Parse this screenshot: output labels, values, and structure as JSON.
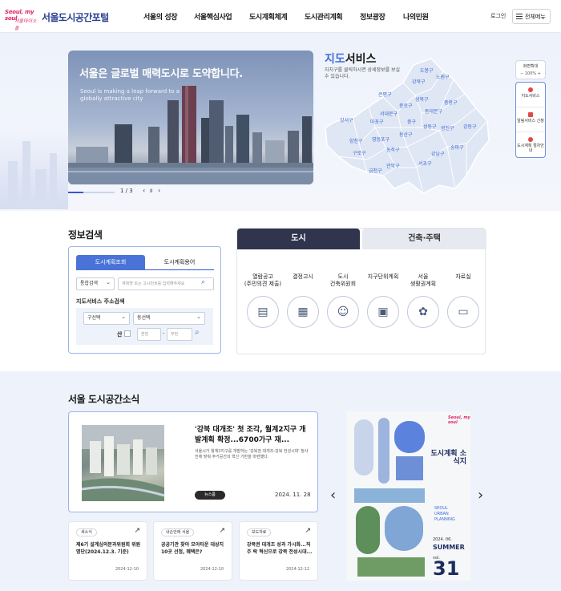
{
  "header": {
    "logo_small1": "Seoul, my soul",
    "logo_small2": "서울마이소울",
    "logo_text": "서울도시공간포털",
    "nav": [
      "서울의 성장",
      "서울핵심사업",
      "도시계획체계",
      "도시관리계획",
      "정보광장",
      "나의민원"
    ],
    "login": "로그인",
    "all_menu": "전체메뉴"
  },
  "hero": {
    "title": "서울은 글로벌 매력도시로 도약합니다.",
    "subtitle": "Seoul is making a leap forward to a globally attractive city",
    "page": "1 / 3",
    "progress": 0.33,
    "prev": "‹",
    "pause": "II",
    "next": "›"
  },
  "map": {
    "title_accent": "지도",
    "title_rest": "서비스",
    "desc": "자치구를 클릭하시면 상세정보를 보실 수 있습니다.",
    "districts": [
      "도봉구",
      "강북구",
      "노원구",
      "은평구",
      "성북구",
      "중랑구",
      "종로구",
      "동대문구",
      "서대문구",
      "강서구",
      "마포구",
      "중구",
      "성동구",
      "광진구",
      "강동구",
      "양천구",
      "용산구",
      "영등포구",
      "동작구",
      "구로구",
      "강남구",
      "송파구",
      "금천구",
      "관악구",
      "서초구"
    ]
  },
  "quick": {
    "zoom_label": "화면확대",
    "zoom_value": "100%",
    "zoom_minus": "−",
    "zoom_plus": "+",
    "items": [
      "지도서비스",
      "알림서비스 신청",
      "도시계획 절차안내"
    ]
  },
  "info_search": {
    "title": "정보검색",
    "tabs": [
      "도시계획조회",
      "도시계획용어"
    ],
    "select_type": "통합검색",
    "search_placeholder": "계획명 또는 고시번호를 입력해주세요",
    "address_label": "지도서비스 주소검색",
    "gu_select": "구선택",
    "dong_select": "동선택",
    "mountain": "산",
    "main_num": "본번",
    "sub_num": "부번",
    "dash": "-"
  },
  "category": {
    "tabs": [
      "도시",
      "건축·주택"
    ],
    "items": [
      {
        "label": "열람공고\n(주민의견 제출)",
        "icon": "chat-icon",
        "glyph": "▤"
      },
      {
        "label": "결정고시",
        "icon": "document-icon",
        "glyph": "▦"
      },
      {
        "label": "도시\n건축위원회",
        "icon": "committee-icon",
        "glyph": "☺"
      },
      {
        "label": "지구단위계획",
        "icon": "plan-icon",
        "glyph": "▣"
      },
      {
        "label": "서울\n생활권계획",
        "icon": "seoul-map-icon",
        "glyph": "✿"
      },
      {
        "label": "자료실",
        "icon": "archive-icon",
        "glyph": "▭"
      }
    ]
  },
  "news": {
    "title": "서울 도시공간소식",
    "feature": {
      "title": "'강북 대개조' 첫 조각, 월계2지구 개발계획 확정...6700가구 재...",
      "desc": "서울시가 월계2지구를 개발하는 '강북권 대개조-강북 전성시대' 청사진에 맞춰 주거공간의 혁신 기반을 마련했다.",
      "badge": "뉴스룸",
      "date": "2024. 11. 28"
    },
    "cards": [
      {
        "badge": "새소식",
        "title": "제6기 설계심의분과위원회 위원 명단(2024.12.3. 기준)",
        "date": "2024-12-10"
      },
      {
        "badge": "내손안에 서울",
        "title": "공공기관 찾아 모아타운 대상지 10곳 선정, 혜택은?",
        "date": "2024-12-10"
      },
      {
        "badge": "보도자료",
        "title": "강북권 대개조 성과 가시화...직주 락 혁신으로 강북 전성시대...",
        "date": "2024-12-12"
      }
    ],
    "magazine": {
      "brand": "Seoul, my soul",
      "title": "도시계획 소식지",
      "en": "SEOUL\nURBAN\nPLANNING",
      "issue": "2024. 06.",
      "season": "SUMMER",
      "vol": "vol.",
      "number": "31"
    },
    "prev": "‹",
    "next": "›"
  },
  "colors": {
    "brand": "#2a3d8f",
    "accent": "#3f6fd8",
    "dark_tab": "#30344d",
    "pink": "#e0256a"
  }
}
